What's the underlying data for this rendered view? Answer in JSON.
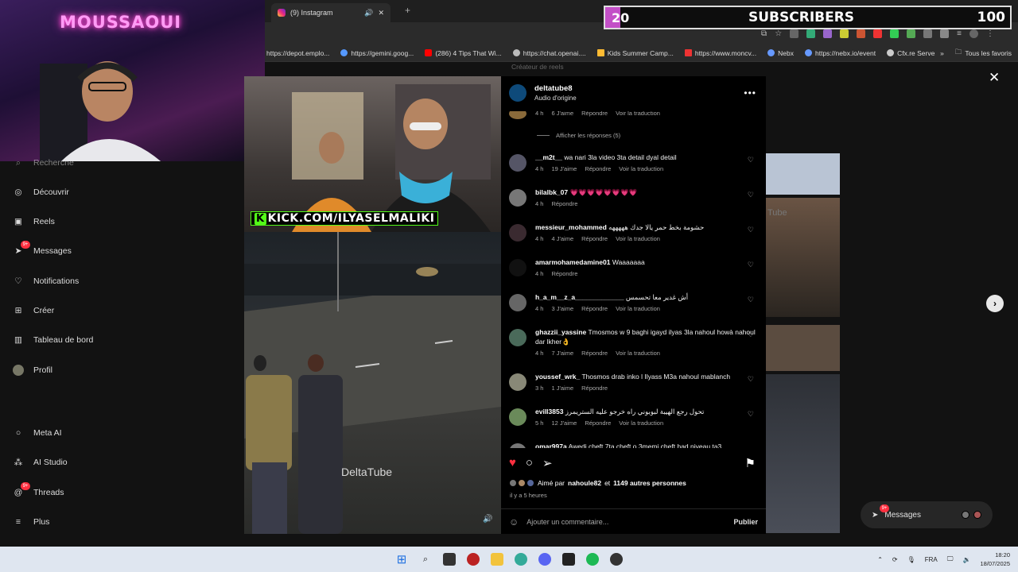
{
  "browser": {
    "tab_title": "(9) Instagram",
    "new_tab_label": "+",
    "bookmarks": [
      "https://depot.emplo...",
      "https://gemini.goog...",
      "(286) 4 Tips That Wi...",
      "https://chat.openai....",
      "Kids Summer Camp...",
      "https://www.moncv...",
      "Nebx",
      "https://nebx.io/event",
      "Cfx.re Server List"
    ],
    "bookmarks_more": "»",
    "all_favorites": "Tous les favoris"
  },
  "overlay": {
    "channel_name": "MOUSSAOUI",
    "sub_current": "20",
    "sub_label": "SUBSCRIBERS",
    "sub_goal": "100",
    "sub_progress": 0.2,
    "sub_fill_color": "#c34fc7"
  },
  "nav": {
    "items": [
      {
        "label": "Recherche",
        "icon": "search-icon"
      },
      {
        "label": "Découvrir",
        "icon": "compass-icon"
      },
      {
        "label": "Reels",
        "icon": "reels-icon"
      },
      {
        "label": "Messages",
        "icon": "messenger-icon",
        "badge": "9+"
      },
      {
        "label": "Notifications",
        "icon": "heart-icon"
      },
      {
        "label": "Créer",
        "icon": "plus-icon"
      },
      {
        "label": "Tableau de bord",
        "icon": "dashboard-icon"
      },
      {
        "label": "Profil",
        "icon": "avatar"
      },
      {
        "label": "Meta AI",
        "icon": "meta-ai-icon"
      },
      {
        "label": "AI Studio",
        "icon": "ai-studio-icon"
      },
      {
        "label": "Threads",
        "icon": "threads-icon",
        "badge": "9+"
      },
      {
        "label": "Plus",
        "icon": "menu-icon"
      }
    ]
  },
  "video": {
    "overlay_text": "KICK.COM/ILYASELMALIKI",
    "watermark": "DeltaTube",
    "volume_icon": "volume-icon"
  },
  "post": {
    "author": "deltatube8",
    "audio": "Audio d'origine",
    "more": "•••",
    "first_meta": {
      "time": "4 h",
      "likes": "6 J'aime",
      "reply": "Répondre",
      "translate": "Voir la traduction"
    },
    "show_replies": "Afficher les réponses (5)",
    "comments": [
      {
        "user": "__m2t__",
        "text": "wa nari 3la video 3ta detail dyal detail",
        "time": "4 h",
        "likes": "19 J'aime",
        "reply": "Répondre",
        "translate": "Voir la traduction"
      },
      {
        "user": "bilalbk_07",
        "text": "💗💗💗💗💗💗💗💗",
        "time": "4 h",
        "likes": "",
        "reply": "Répondre",
        "translate": ""
      },
      {
        "user": "messieur_mohammed",
        "text": "حشومة بخط حمر يالا جدك هههههه",
        "time": "4 h",
        "likes": "4 J'aime",
        "reply": "Répondre",
        "translate": "Voir la traduction"
      },
      {
        "user": "amarmohamedamine01",
        "text": "Waaaaaaa",
        "time": "4 h",
        "likes": "",
        "reply": "Répondre",
        "translate": ""
      },
      {
        "user": "h_a_m__z_a_____________",
        "text": "أش غدير معا تحسمس",
        "time": "4 h",
        "likes": "3 J'aime",
        "reply": "Répondre",
        "translate": "Voir la traduction"
      },
      {
        "user": "ghazzii_yassine",
        "text": "Tmosmos w 9 baghi igayd ilyas 3la nahoul howà nahoul dar lkher👌",
        "time": "4 h",
        "likes": "7 J'aime",
        "reply": "Répondre",
        "translate": "Voir la traduction"
      },
      {
        "user": "youssef_wrk_",
        "text": "Thosmos drab inko l Ilyass M3a nahoul mablanch",
        "time": "3 h",
        "likes": "1 J'aime",
        "reply": "Répondre",
        "translate": ""
      },
      {
        "user": "evill3853",
        "text": "تحول رجع الهيبة لبوبوني راه خرجو عليه الستريمرز",
        "time": "5 h",
        "likes": "12 J'aime",
        "reply": "Répondre",
        "translate": "Voir la traduction"
      },
      {
        "user": "omar997a",
        "text": "Awedi cheft 7ta cheft o 3memi cheft had niveau ta3",
        "time": "",
        "likes": "",
        "reply": "",
        "translate": ""
      }
    ],
    "liked_by_prefix": "Aimé par",
    "liked_by_user": "nahoule82",
    "liked_by_and": "et",
    "liked_by_others": "1149 autres personnes",
    "posted_ago": "il y a 5 heures",
    "comment_placeholder": "Ajouter un commentaire...",
    "publish": "Publier"
  },
  "background": {
    "creator_note": "Créateur de reels",
    "faded_text": "Tube",
    "messages_pill": "Messages",
    "messages_badge": "9+",
    "close": "✕",
    "next": "›"
  },
  "taskbar": {
    "lang": "FRA",
    "time": "18:20",
    "date": "18/07/2025"
  },
  "colors": {
    "accent_like": "#ff3040",
    "kick_green": "#53fc18"
  }
}
